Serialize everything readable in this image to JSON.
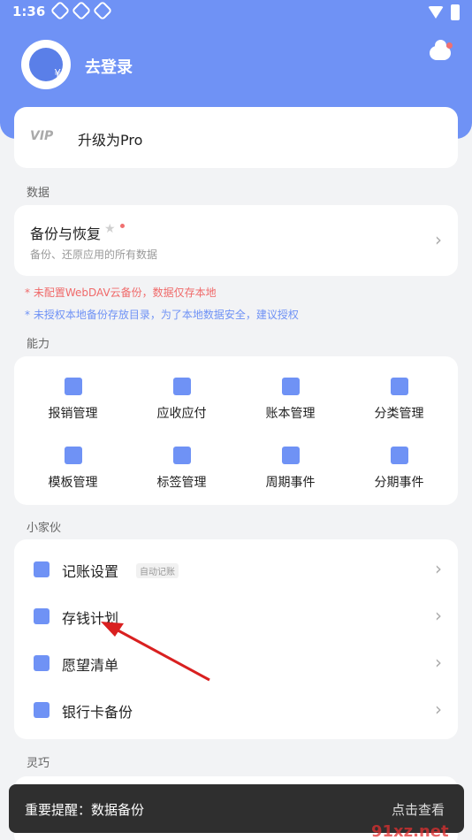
{
  "status_bar": {
    "time": "1:36"
  },
  "profile": {
    "login_text": "去登录"
  },
  "pro": {
    "logo": "VIP",
    "label": "升级为Pro"
  },
  "sections": {
    "data": "数据",
    "abilities": "能力",
    "widgets": "小家伙",
    "smart": "灵巧"
  },
  "backup": {
    "title": "备份与恢复",
    "subtitle": "备份、还原应用的所有数据"
  },
  "warnings": {
    "webdav": "* 未配置WebDAV云备份，数据仅存本地",
    "authorize": "* 未授权本地备份存放目录，为了本地数据安全，建议授权"
  },
  "abilities": [
    {
      "label": "报销管理",
      "icon": "reimbursement-icon"
    },
    {
      "label": "应收应付",
      "icon": "layers-icon"
    },
    {
      "label": "账本管理",
      "icon": "book-icon"
    },
    {
      "label": "分类管理",
      "icon": "category-icon"
    },
    {
      "label": "模板管理",
      "icon": "cube-icon"
    },
    {
      "label": "标签管理",
      "icon": "tag-icon"
    },
    {
      "label": "周期事件",
      "icon": "cycle-icon"
    },
    {
      "label": "分期事件",
      "icon": "clock-icon"
    }
  ],
  "widgets": [
    {
      "label": "记账设置",
      "tag": "自动记账",
      "icon": "wrench-icon"
    },
    {
      "label": "存钱计划",
      "icon": "flag-icon"
    },
    {
      "label": "愿望清单",
      "icon": "star-icon"
    },
    {
      "label": "银行卡备份",
      "icon": "card-icon"
    }
  ],
  "toast": {
    "text": "重要提醒：数据备份",
    "action": "点击查看"
  },
  "watermark": {
    "text": "91xz.net"
  },
  "colors": {
    "accent": "#6f92f5",
    "warning": "#f06a6a",
    "annotation_arrow": "#d92020"
  }
}
